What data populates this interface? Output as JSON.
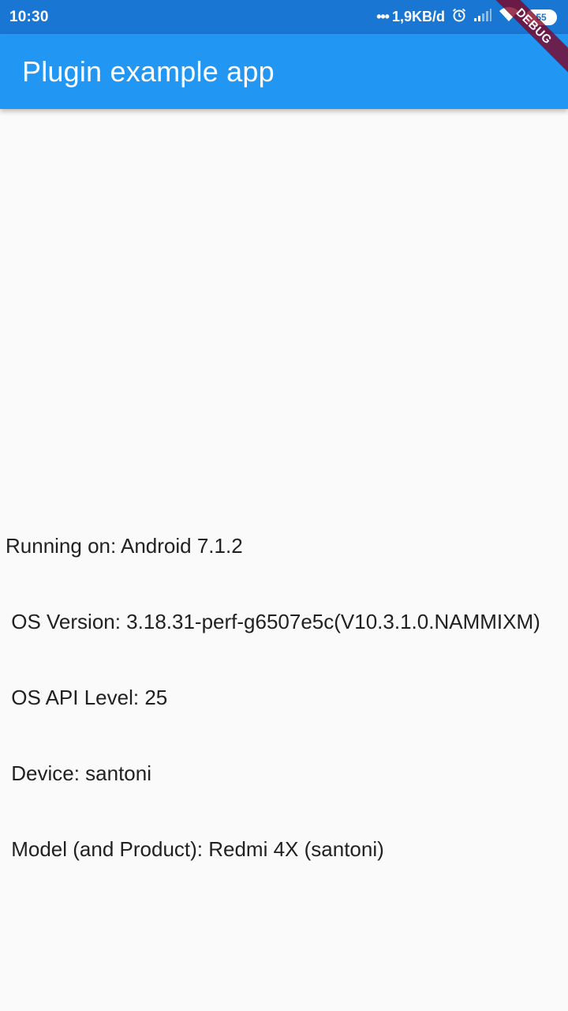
{
  "status_bar": {
    "time": "10:30",
    "dots": "•••",
    "network_speed": "1,9KB/d",
    "battery_level": "55",
    "alarm_icon": "alarm-clock-icon",
    "signal_icon": "cell-signal-icon",
    "wifi_icon": "wifi-icon",
    "battery_icon": "battery-icon"
  },
  "app_bar": {
    "title": "Plugin example app",
    "color": "#2196f3"
  },
  "debug_banner": {
    "label": "DEBUG"
  },
  "info": {
    "line1": "Running on: Android 7.1.2",
    "line2": " OS Version: 3.18.31-perf-g6507e5c(V10.3.1.0.NAMMIXM)",
    "line3": " OS API Level: 25",
    "line4": " Device: santoni",
    "line5": " Model (and Product): Redmi 4X (santoni)"
  }
}
